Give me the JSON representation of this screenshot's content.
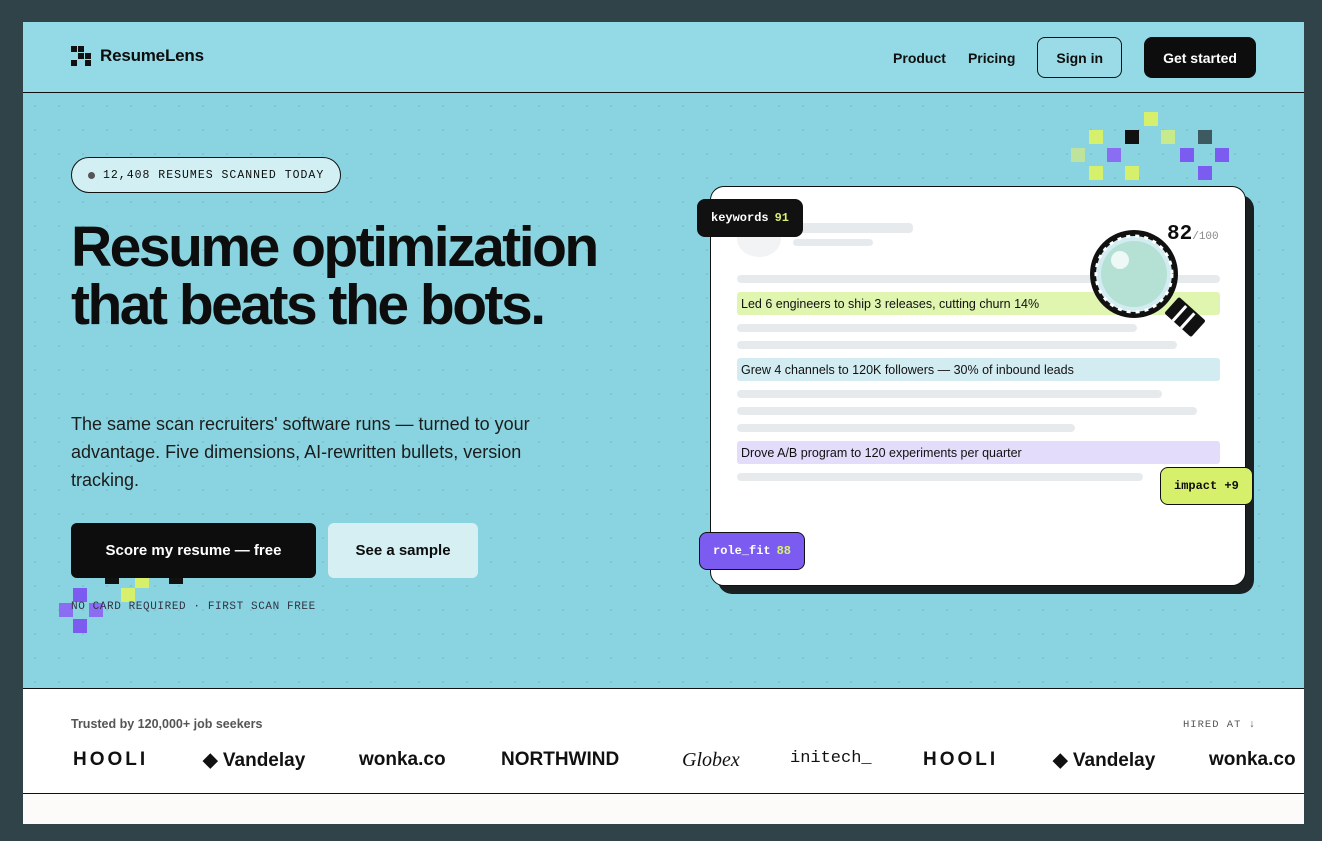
{
  "header": {
    "brand": "ResumeLens",
    "nav": [
      "Product",
      "Pricing"
    ],
    "sign_in": "Sign in",
    "get_started": "Get started"
  },
  "hero": {
    "badge": "12,408 RESUMES SCANNED TODAY",
    "title": "Resume optimization that beats the bots.",
    "subtitle": "The same scan recruiters' software runs — turned to your advantage. Five dimensions, AI-rewritten bullets, version tracking.",
    "primary_cta": "Score my resume — free",
    "secondary_cta": "See a sample",
    "note": "NO CARD REQUIRED · FIRST SCAN FREE"
  },
  "card": {
    "score": "82",
    "score_max": "/100",
    "highlights": [
      {
        "text": "Led 6 engineers to ship 3 releases, cutting churn 14%",
        "color": "#dff5b0"
      },
      {
        "text": "Grew 4 channels to 120K followers — 30% of inbound leads",
        "color": "#d3ecf1"
      },
      {
        "text": "Drove A/B program to 120 experiments per quarter",
        "color": "#e3dcfa"
      }
    ],
    "tags": {
      "keywords_label": "keywords",
      "keywords_value": "91",
      "impact": "impact +9",
      "role_fit_label": "role_fit",
      "role_fit_value": "88"
    }
  },
  "logos": {
    "trusted": "Trusted by 120,000+ job seekers",
    "hired_at": "HIRED AT ↓",
    "items": [
      "HOOLI",
      "◆ Vandelay",
      "wonka.co",
      "NORTHWIND",
      "Globex",
      "initech_",
      "HOOLI",
      "◆ Vandelay",
      "wonka.co"
    ]
  },
  "colors": {
    "hero_bg": "#89d4e0",
    "lime": "#d7f06c",
    "purple": "#7c5cf0",
    "dark": "#0d0d0d"
  }
}
